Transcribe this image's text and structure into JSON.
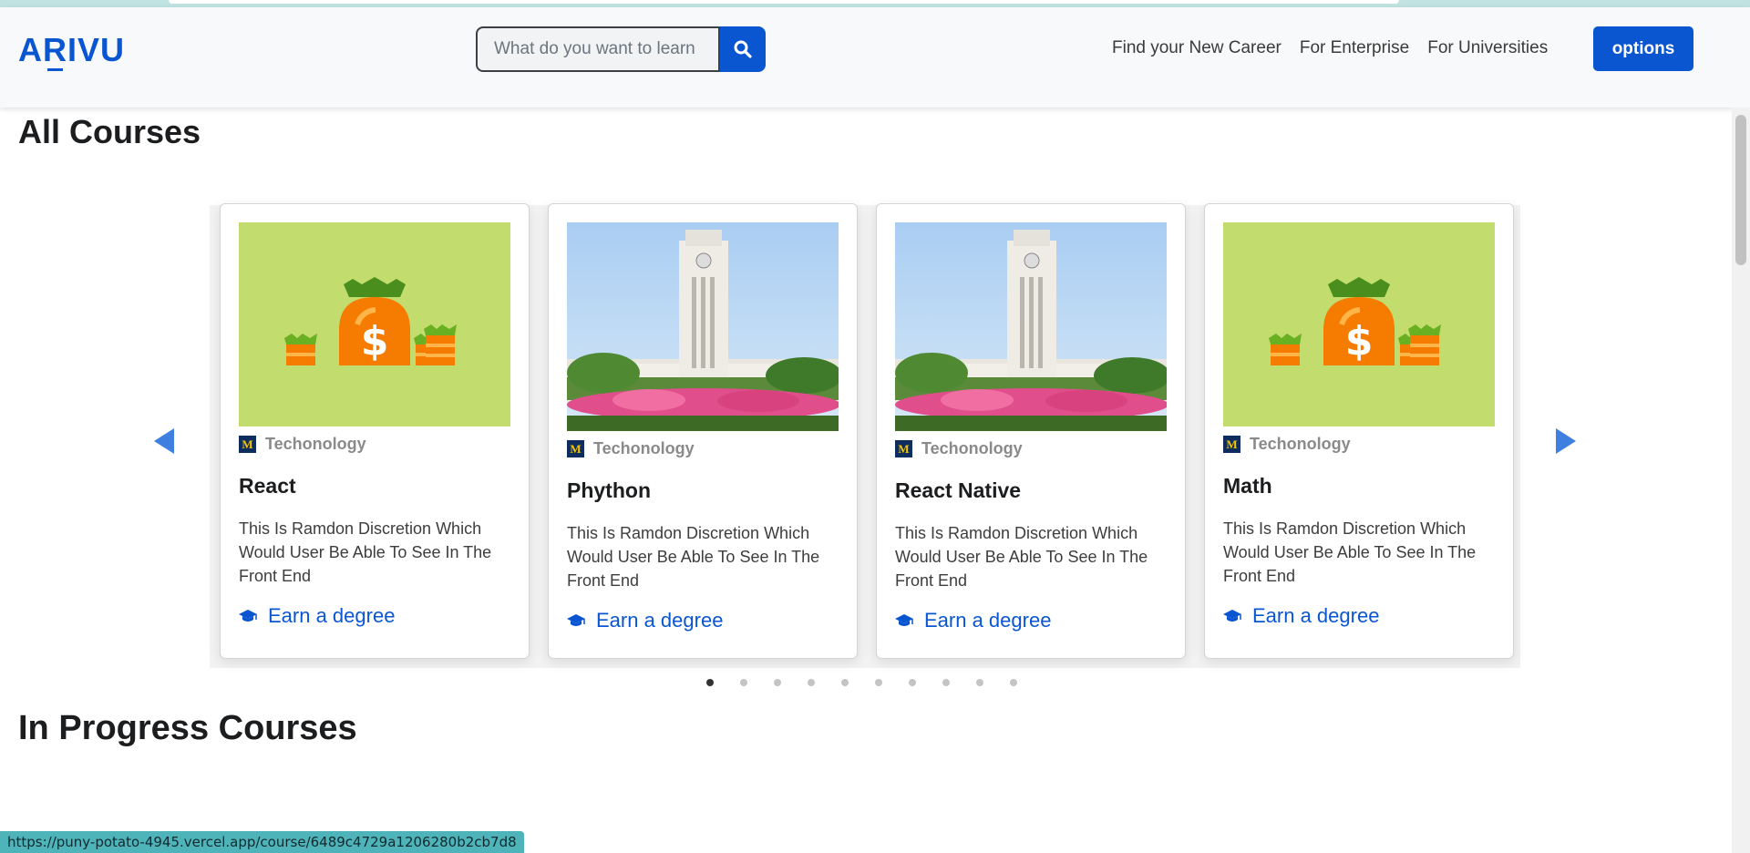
{
  "header": {
    "logo": "ARIVU",
    "search_placeholder": "What do you want to learn",
    "nav_links": [
      "Find your New Career",
      "For Enterprise",
      "For Universities"
    ],
    "options_label": "options"
  },
  "sections": {
    "all_courses": "All Courses",
    "in_progress": "In Progress Courses"
  },
  "courses": [
    {
      "image": "money-bag-illustration",
      "university_logo": "M",
      "category": "Techonology",
      "title": "React",
      "description": "This Is Ramdon Discretion Which Would User Be Able To See In The Front End",
      "cta": "Earn a degree"
    },
    {
      "image": "campus-clock-tower-photo",
      "university_logo": "M",
      "category": "Techonology",
      "title": "Phython",
      "description": "This Is Ramdon Discretion Which Would User Be Able To See In The Front End",
      "cta": "Earn a degree"
    },
    {
      "image": "campus-clock-tower-photo",
      "university_logo": "M",
      "category": "Techonology",
      "title": "React Native",
      "description": "This Is Ramdon Discretion Which Would User Be Able To See In The Front End",
      "cta": "Earn a degree"
    },
    {
      "image": "money-bag-illustration",
      "university_logo": "M",
      "category": "Techonology",
      "title": "Math",
      "description": "This Is Ramdon Discretion Which Would User Be Able To See In The Front End",
      "cta": "Earn a degree"
    }
  ],
  "carousel": {
    "dot_count": 10,
    "active_dot": 1
  },
  "status_url": "https://puny-potato-4945.vercel.app/course/6489c4729a1206280b2cb7d8",
  "colors": {
    "brand": "#0a56d0",
    "card_border": "#d4d4d4",
    "illustration_bg": "#c3dc6e"
  }
}
